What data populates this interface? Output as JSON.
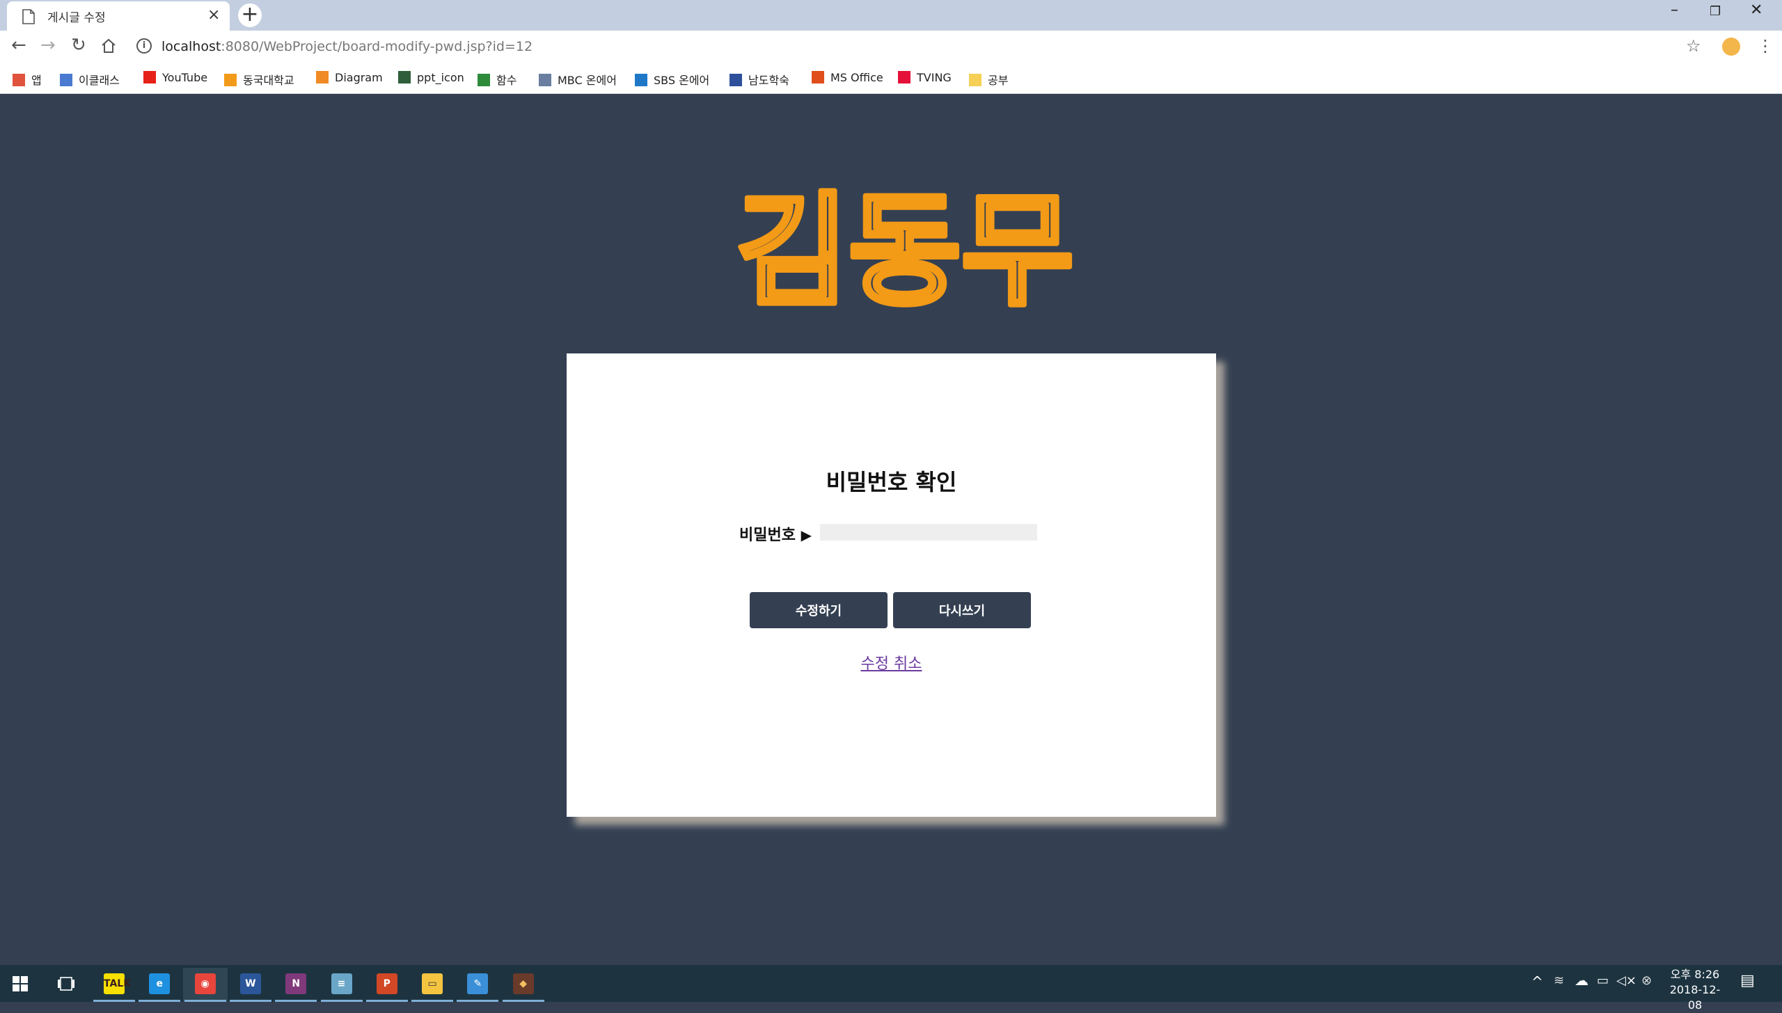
{
  "browser": {
    "tab_title": "게시글 수정",
    "tab_close": "×",
    "new_tab": "+",
    "url_host": "localhost",
    "url_rest": ":8080/WebProject/board-modify-pwd.jsp?id=12",
    "window_controls": [
      "–",
      "❐",
      "✕"
    ]
  },
  "bookmarks": [
    {
      "label": "앱",
      "icon": "apps-grid-icon",
      "color": "#e0533d"
    },
    {
      "label": "이클래스",
      "icon": "eclass-icon",
      "color": "#4a7bd0"
    },
    {
      "label": "YouTube",
      "icon": "youtube-icon",
      "color": "#e62117"
    },
    {
      "label": "동국대학교",
      "icon": "dongguk-icon",
      "color": "#f29a1a"
    },
    {
      "label": "Diagram",
      "icon": "diagram-icon",
      "color": "#f08a24"
    },
    {
      "label": "ppt_icon",
      "icon": "ppt-icon-bookmark",
      "color": "#2f5f3a"
    },
    {
      "label": "함수",
      "icon": "function-icon",
      "color": "#2e8b3a"
    },
    {
      "label": "MBC 온에어",
      "icon": "mbc-icon",
      "color": "#6a7fa0"
    },
    {
      "label": "SBS 온에어",
      "icon": "sbs-icon",
      "color": "#1e78c8"
    },
    {
      "label": "남도학숙",
      "icon": "namdo-icon",
      "color": "#2e4f9a"
    },
    {
      "label": "MS Office",
      "icon": "office-icon",
      "color": "#e04e1b"
    },
    {
      "label": "TVING",
      "icon": "tving-icon",
      "color": "#e5113a"
    },
    {
      "label": "공부",
      "icon": "folder-icon",
      "color": "#f5cf56"
    }
  ],
  "page": {
    "logo_text": "김동무",
    "logo_color": "#f39a17",
    "card_title": "비밀번호 확인",
    "password_label": "비밀번호",
    "password_arrow": "▶",
    "modify_button": "수정하기",
    "reset_button": "다시쓰기",
    "cancel_link": "수정 취소"
  },
  "taskbar": {
    "apps": [
      {
        "name": "kakaotalk",
        "label": "TALK",
        "color": "#f7e000",
        "text": "#3b1e1e",
        "running": true
      },
      {
        "name": "internet-explorer",
        "label": "e",
        "color": "#1e90e0",
        "text": "#fff",
        "running": true
      },
      {
        "name": "chrome",
        "label": "◉",
        "color": "#e8453c",
        "text": "#fff",
        "running": true
      },
      {
        "name": "word",
        "label": "W",
        "color": "#2b579a",
        "text": "#fff",
        "running": true
      },
      {
        "name": "onenote",
        "label": "N",
        "color": "#80397b",
        "text": "#fff",
        "running": true
      },
      {
        "name": "notepad",
        "label": "≡",
        "color": "#6aa6c8",
        "text": "#fff",
        "running": true
      },
      {
        "name": "powerpoint",
        "label": "P",
        "color": "#d24726",
        "text": "#fff",
        "running": true
      },
      {
        "name": "file-explorer",
        "label": "▭",
        "color": "#f5c542",
        "text": "#333",
        "running": true
      },
      {
        "name": "app-editor",
        "label": "✎",
        "color": "#3a8fd8",
        "text": "#fff",
        "running": true
      },
      {
        "name": "app-game",
        "label": "◆",
        "color": "#6a3a2a",
        "text": "#f0c060",
        "running": true
      }
    ],
    "clock_time": "오후 8:26",
    "clock_date": "2018-12-08"
  }
}
